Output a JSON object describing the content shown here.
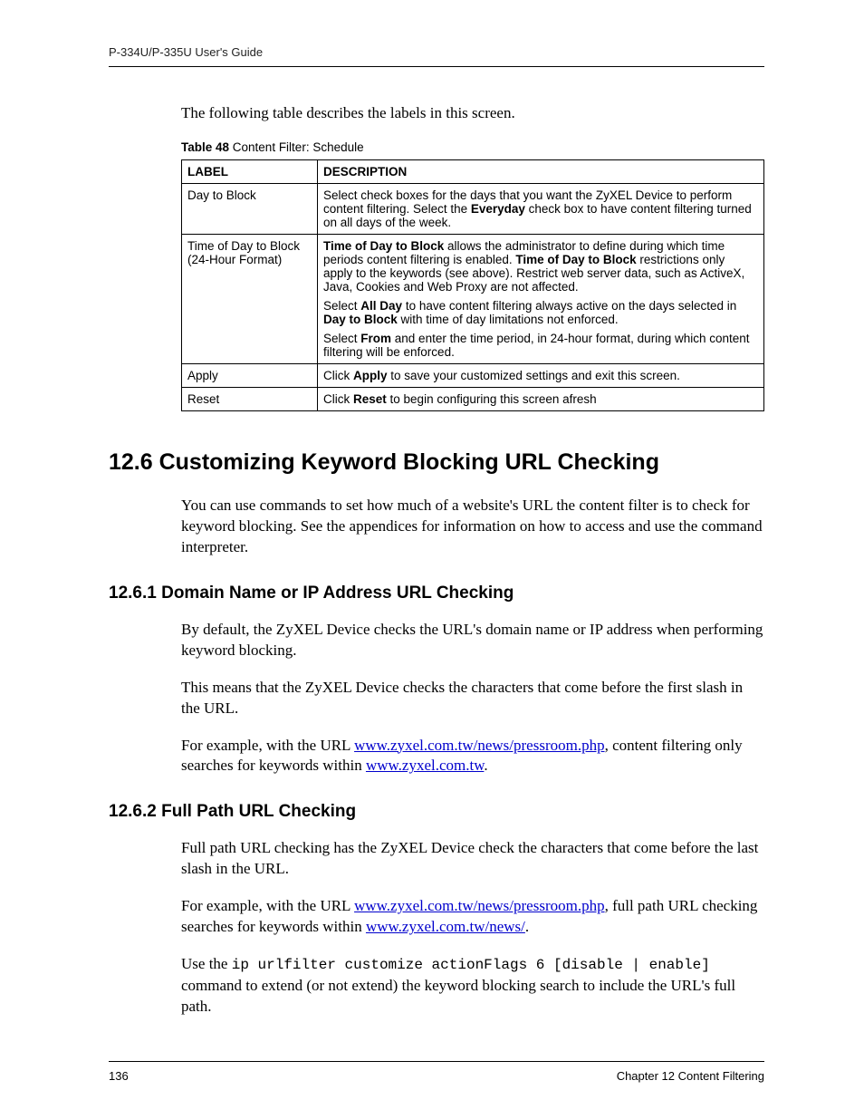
{
  "header": {
    "guide_title": "P-334U/P-335U User's Guide"
  },
  "intro_para": "The following table describes the labels in this screen.",
  "table": {
    "caption_bold": "Table 48",
    "caption_rest": "   Content Filter: Schedule",
    "headers": {
      "label": "LABEL",
      "desc": "DESCRIPTION"
    },
    "rows": [
      {
        "label": "Day to Block",
        "desc_pre": "Select check boxes for the days that you want the ZyXEL Device to perform content filtering. Select the ",
        "desc_bold": "Everyday",
        "desc_post": " check box to have content filtering turned on all days of the week."
      },
      {
        "label": "Time of Day to Block (24-Hour Format)",
        "p1_b1": "Time of Day to Block",
        "p1_a": " allows the administrator to define during which time periods content filtering is enabled. ",
        "p1_b2": "Time of Day to Block",
        "p1_c": " restrictions only apply to the keywords (see above). Restrict web server data, such as ActiveX, Java, Cookies and Web Proxy are not affected.",
        "p2_a": "Select  ",
        "p2_b1": "All Day",
        "p2_b": " to have content filtering always active on the days selected in ",
        "p2_b2": "Day to Block",
        "p2_c": " with time of day limitations not enforced.",
        "p3_a": "Select ",
        "p3_b1": "From",
        "p3_b": " and enter the time period, in 24-hour format, during which content filtering will be enforced."
      },
      {
        "label": "Apply",
        "desc_pre": "Click ",
        "desc_bold": "Apply",
        "desc_post": " to save your customized settings and exit this screen."
      },
      {
        "label": "Reset",
        "desc_pre": "Click ",
        "desc_bold": "Reset",
        "desc_post": " to begin configuring this screen afresh"
      }
    ]
  },
  "section_12_6": {
    "heading": "12.6  Customizing Keyword Blocking URL Checking",
    "para": "You can use commands to set how much of a website's URL the content filter is to check for keyword blocking. See the appendices for information on how to access and use the command interpreter."
  },
  "section_12_6_1": {
    "heading": "12.6.1  Domain Name or IP Address URL Checking",
    "p1": "By default, the ZyXEL Device checks the URL's domain name or IP address when performing keyword blocking.",
    "p2": "This means that the ZyXEL Device checks the characters that come before the first slash in the URL.",
    "p3_a": "For example, with the URL ",
    "p3_link1": "www.zyxel.com.tw/news/pressroom.php",
    "p3_b": ", content filtering only searches for keywords within ",
    "p3_link2": "www.zyxel.com.tw",
    "p3_c": "."
  },
  "section_12_6_2": {
    "heading": "12.6.2  Full Path URL Checking",
    "p1": "Full path URL checking has the ZyXEL Device check the characters that come before the last slash in the URL.",
    "p2_a": "For example, with the URL ",
    "p2_link1": "www.zyxel.com.tw/news/pressroom.php",
    "p2_b": ", full path URL checking searches for keywords within ",
    "p2_link2": "www.zyxel.com.tw/news/",
    "p2_c": ".",
    "p3_a": "Use the ",
    "p3_code": "ip urlfilter customize actionFlags 6 [disable | enable]",
    "p3_b": " command to extend (or not extend) the keyword blocking search to include the URL's full path."
  },
  "footer": {
    "page_number": "136",
    "chapter": "Chapter 12 Content Filtering"
  }
}
